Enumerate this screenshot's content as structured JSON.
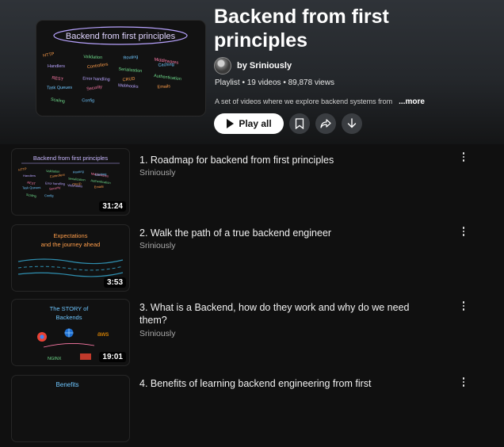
{
  "playlist": {
    "title": "Backend from first principles",
    "owner": "by Sriniously",
    "meta": "Playlist • 19 videos • 89,878 views",
    "description": "A set of videos where we explore backend systems from",
    "more_label": "...more",
    "play_all_label": "Play all",
    "thumb_heading": "Backend from first principles",
    "thumb_words": [
      "HTTP",
      "Validation",
      "Routing",
      "Middlewares",
      "Handlers",
      "Controllers",
      "Serialization",
      "Caching",
      "REST",
      "Error handling",
      "CRUD",
      "Authentication",
      "Task Queues",
      "Security",
      "Webhooks",
      "Emails",
      "Scaling",
      "Config"
    ]
  },
  "videos": [
    {
      "title": "1. Roadmap for backend from first principles",
      "channel": "Sriniously",
      "duration": "31:24",
      "thumb_text": "Backend from first principles"
    },
    {
      "title": "2. Walk the path of a true backend engineer",
      "channel": "Sriniously",
      "duration": "3:53",
      "thumb_text": "Expectations and the journey ahead"
    },
    {
      "title": "3. What is a Backend, how do they work and why do we need them?",
      "channel": "Sriniously",
      "duration": "19:01",
      "thumb_text": "The STORY of Backends"
    },
    {
      "title": "4. Benefits of learning backend engineering from first",
      "channel": "",
      "duration": "",
      "thumb_text": "Benefits"
    }
  ],
  "colors": {
    "accent_purple": "#b8a3ff",
    "accent_orange": "#ff9e4a",
    "accent_green": "#6fdc8c",
    "accent_blue": "#6ec6ff",
    "accent_pink": "#ff7aa8"
  }
}
